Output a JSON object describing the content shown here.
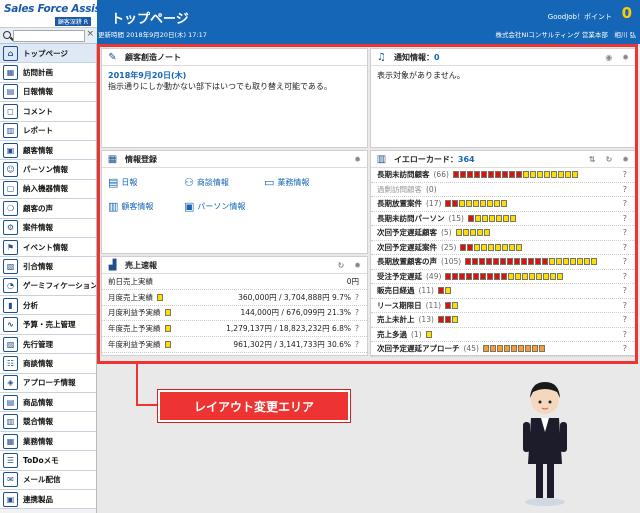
{
  "brand": {
    "name": "Sales Force Assistant",
    "sub": "顧客深耕 R"
  },
  "search": {
    "placeholder": ""
  },
  "sidebar": {
    "items": [
      {
        "label": "トップページ",
        "icon": "home-icon"
      },
      {
        "label": "訪問計画",
        "icon": "calendar-icon"
      },
      {
        "label": "日報情報",
        "icon": "document-icon"
      },
      {
        "label": "コメント",
        "icon": "comment-icon"
      },
      {
        "label": "レポート",
        "icon": "report-icon"
      },
      {
        "label": "顧客情報",
        "icon": "building-icon"
      },
      {
        "label": "パーソン情報",
        "icon": "person-icon"
      },
      {
        "label": "納入機器情報",
        "icon": "device-icon"
      },
      {
        "label": "顧客の声",
        "icon": "voice-icon"
      },
      {
        "label": "案件情報",
        "icon": "gear-icon"
      },
      {
        "label": "イベント情報",
        "icon": "flag-icon"
      },
      {
        "label": "引合情報",
        "icon": "inquiry-icon"
      },
      {
        "label": "ゲーミフィケーション",
        "icon": "game-icon"
      },
      {
        "label": "分析",
        "icon": "chart-icon"
      },
      {
        "label": "予算・売上管理",
        "icon": "graph-icon"
      },
      {
        "label": "先行管理",
        "icon": "schedule-icon"
      },
      {
        "label": "商談情報",
        "icon": "handshake-icon"
      },
      {
        "label": "アプローチ情報",
        "icon": "approach-icon"
      },
      {
        "label": "商品情報",
        "icon": "product-icon"
      },
      {
        "label": "競合情報",
        "icon": "competitor-icon"
      },
      {
        "label": "業務情報",
        "icon": "business-icon"
      },
      {
        "label": "ToDoメモ",
        "icon": "todo-icon"
      },
      {
        "label": "メール配信",
        "icon": "mail-icon"
      },
      {
        "label": "連携製品",
        "icon": "link-icon"
      }
    ]
  },
  "header": {
    "title": "トップページ",
    "updated": "更新時間 2018年9月20日(木) 17:17",
    "goodjob": "GoodJob！ポイント",
    "points": "0",
    "company": "株式会社NIコンサルティング 営業本部　相川 弘"
  },
  "panels": {
    "notebook": {
      "title": "顧客創造ノート",
      "date": "2018年9月20日(木)",
      "text": "指示通りにしか動かない部下はいつでも取り替え可能である。"
    },
    "notice": {
      "title": "通知情報：",
      "count": "0",
      "empty": "表示対象がありません。"
    },
    "register": {
      "title": "情報登録",
      "links": [
        "日報",
        "商談情報",
        "業務情報",
        "顧客情報",
        "パーソン情報"
      ]
    },
    "yellow": {
      "title": "イエローカード：",
      "count": "364",
      "rows": [
        {
          "label": "長期未訪問顧客",
          "count": "(66)",
          "r": 10,
          "y": 8
        },
        {
          "label": "過剰訪問顧客",
          "count": "(0)",
          "r": 0,
          "y": 0
        },
        {
          "label": "長期放置案件",
          "count": "(17)",
          "r": 2,
          "y": 7
        },
        {
          "label": "長期未訪問パーソン",
          "count": "(15)",
          "r": 1,
          "y": 6
        },
        {
          "label": "次回予定遅延顧客",
          "count": "(5)",
          "r": 0,
          "y": 5
        },
        {
          "label": "次回予定遅延案件",
          "count": "(25)",
          "r": 2,
          "y": 7
        },
        {
          "label": "長期放置顧客の声",
          "count": "(105)",
          "r": 12,
          "y": 7
        },
        {
          "label": "受注予定遅延",
          "count": "(49)",
          "r": 9,
          "y": 8
        },
        {
          "label": "販売日経過",
          "count": "(11)",
          "r": 1,
          "y": 1
        },
        {
          "label": "リース期限日",
          "count": "(11)",
          "r": 1,
          "y": 1
        },
        {
          "label": "売上未計上",
          "count": "(13)",
          "r": 2,
          "y": 1
        },
        {
          "label": "売上多過",
          "count": "(1)",
          "r": 0,
          "y": 1
        },
        {
          "label": "次回予定遅延アプローチ",
          "count": "(45)",
          "r": 0,
          "y": 0,
          "o": 9
        }
      ]
    },
    "sales": {
      "title": "売上速報",
      "rows": [
        {
          "label": "前日売上実績",
          "value": "0円"
        },
        {
          "label": "月度売上実績",
          "value": "360,000円 / 3,704,888円 9.7%"
        },
        {
          "label": "月度利益予実績",
          "value": "144,000円 / 676,099円 21.3%"
        },
        {
          "label": "年度売上予実績",
          "value": "1,279,137円 / 18,823,232円 6.8%"
        },
        {
          "label": "年度利益予実績",
          "value": "961,302円 / 3,141,733円 30.6%"
        }
      ]
    }
  },
  "callout": {
    "label": "レイアウト変更エリア"
  },
  "colors": {
    "header": "#1566b6",
    "highlight": "#e33333",
    "accent_yellow": "#ffdd00"
  }
}
